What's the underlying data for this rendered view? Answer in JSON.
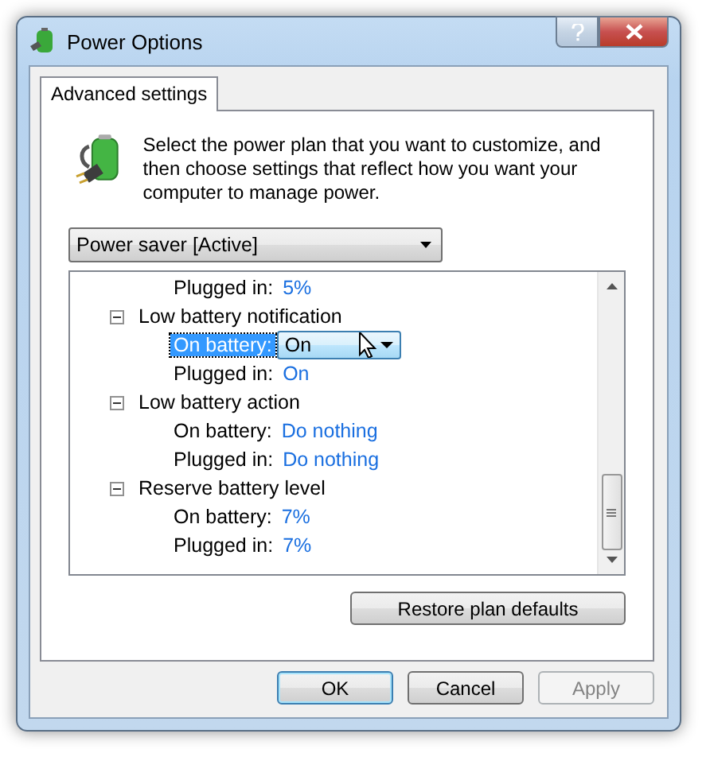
{
  "window": {
    "title": "Power Options"
  },
  "tabs": [
    {
      "label": "Advanced settings",
      "selected": true
    }
  ],
  "intro": "Select the power plan that you want to customize, and then choose settings that reflect how you want your computer to manage power.",
  "plan_select": {
    "value": "Power saver [Active]"
  },
  "tree": {
    "leading_rows": [
      {
        "label": "Plugged in:",
        "value": "5%",
        "selected": false,
        "kind": "link"
      }
    ],
    "groups": [
      {
        "label": "Low battery notification",
        "expanded": true,
        "children": [
          {
            "label": "On battery:",
            "value": "On",
            "selected": true,
            "kind": "dropdown"
          },
          {
            "label": "Plugged in:",
            "value": "On",
            "selected": false,
            "kind": "link"
          }
        ]
      },
      {
        "label": "Low battery action",
        "expanded": true,
        "children": [
          {
            "label": "On battery:",
            "value": "Do nothing",
            "selected": false,
            "kind": "link"
          },
          {
            "label": "Plugged in:",
            "value": "Do nothing",
            "selected": false,
            "kind": "link"
          }
        ]
      },
      {
        "label": "Reserve battery level",
        "expanded": true,
        "children": [
          {
            "label": "On battery:",
            "value": "7%",
            "selected": false,
            "kind": "link"
          },
          {
            "label": "Plugged in:",
            "value": "7%",
            "selected": false,
            "kind": "link"
          }
        ]
      }
    ]
  },
  "restore_button": "Restore plan defaults",
  "buttons": [
    {
      "label": "OK",
      "default": true,
      "disabled": false
    },
    {
      "label": "Cancel",
      "default": false,
      "disabled": false
    },
    {
      "label": "Apply",
      "default": false,
      "disabled": true
    }
  ]
}
